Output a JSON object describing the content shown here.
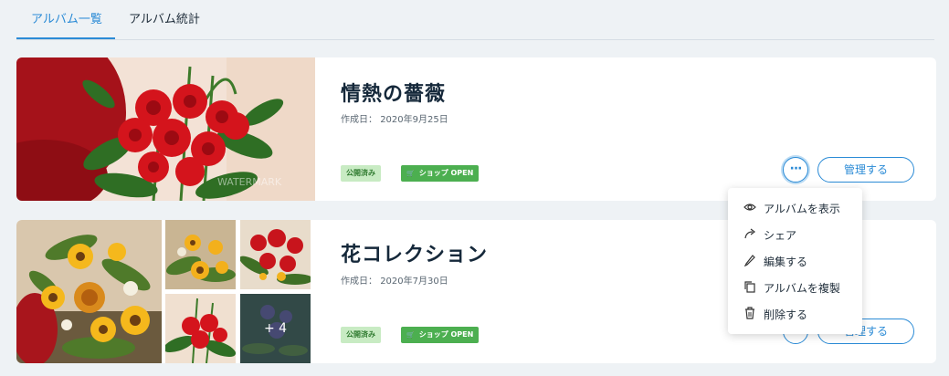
{
  "tabs": [
    {
      "label": "アルバム一覧",
      "active": true
    },
    {
      "label": "アルバム統計",
      "active": false
    }
  ],
  "albums": [
    {
      "title": "情熱の薔薇",
      "created_label": "作成日：",
      "created_date": "2020年9月25日",
      "badge_published": "公開済み",
      "badge_shop": "ショップ OPEN",
      "manage_label": "管理する",
      "more_label": "···"
    },
    {
      "title": "花コレクション",
      "created_label": "作成日：",
      "created_date": "2020年7月30日",
      "badge_published": "公開済み",
      "badge_shop": "ショップ OPEN",
      "manage_label": "管理する",
      "more_label": "···",
      "extra_photos": "+ 4"
    }
  ],
  "menu": {
    "items": [
      {
        "label": "アルバムを表示",
        "icon": "eye-icon"
      },
      {
        "label": "シェア",
        "icon": "share-icon"
      },
      {
        "label": "編集する",
        "icon": "pencil-icon"
      },
      {
        "label": "アルバムを複製",
        "icon": "duplicate-icon"
      },
      {
        "label": "削除する",
        "icon": "trash-icon"
      }
    ]
  },
  "watermark": "WATERMARK",
  "colors": {
    "accent": "#2b8bd6",
    "published_bg": "#c8ebc3",
    "shop_bg": "#4caf50"
  }
}
